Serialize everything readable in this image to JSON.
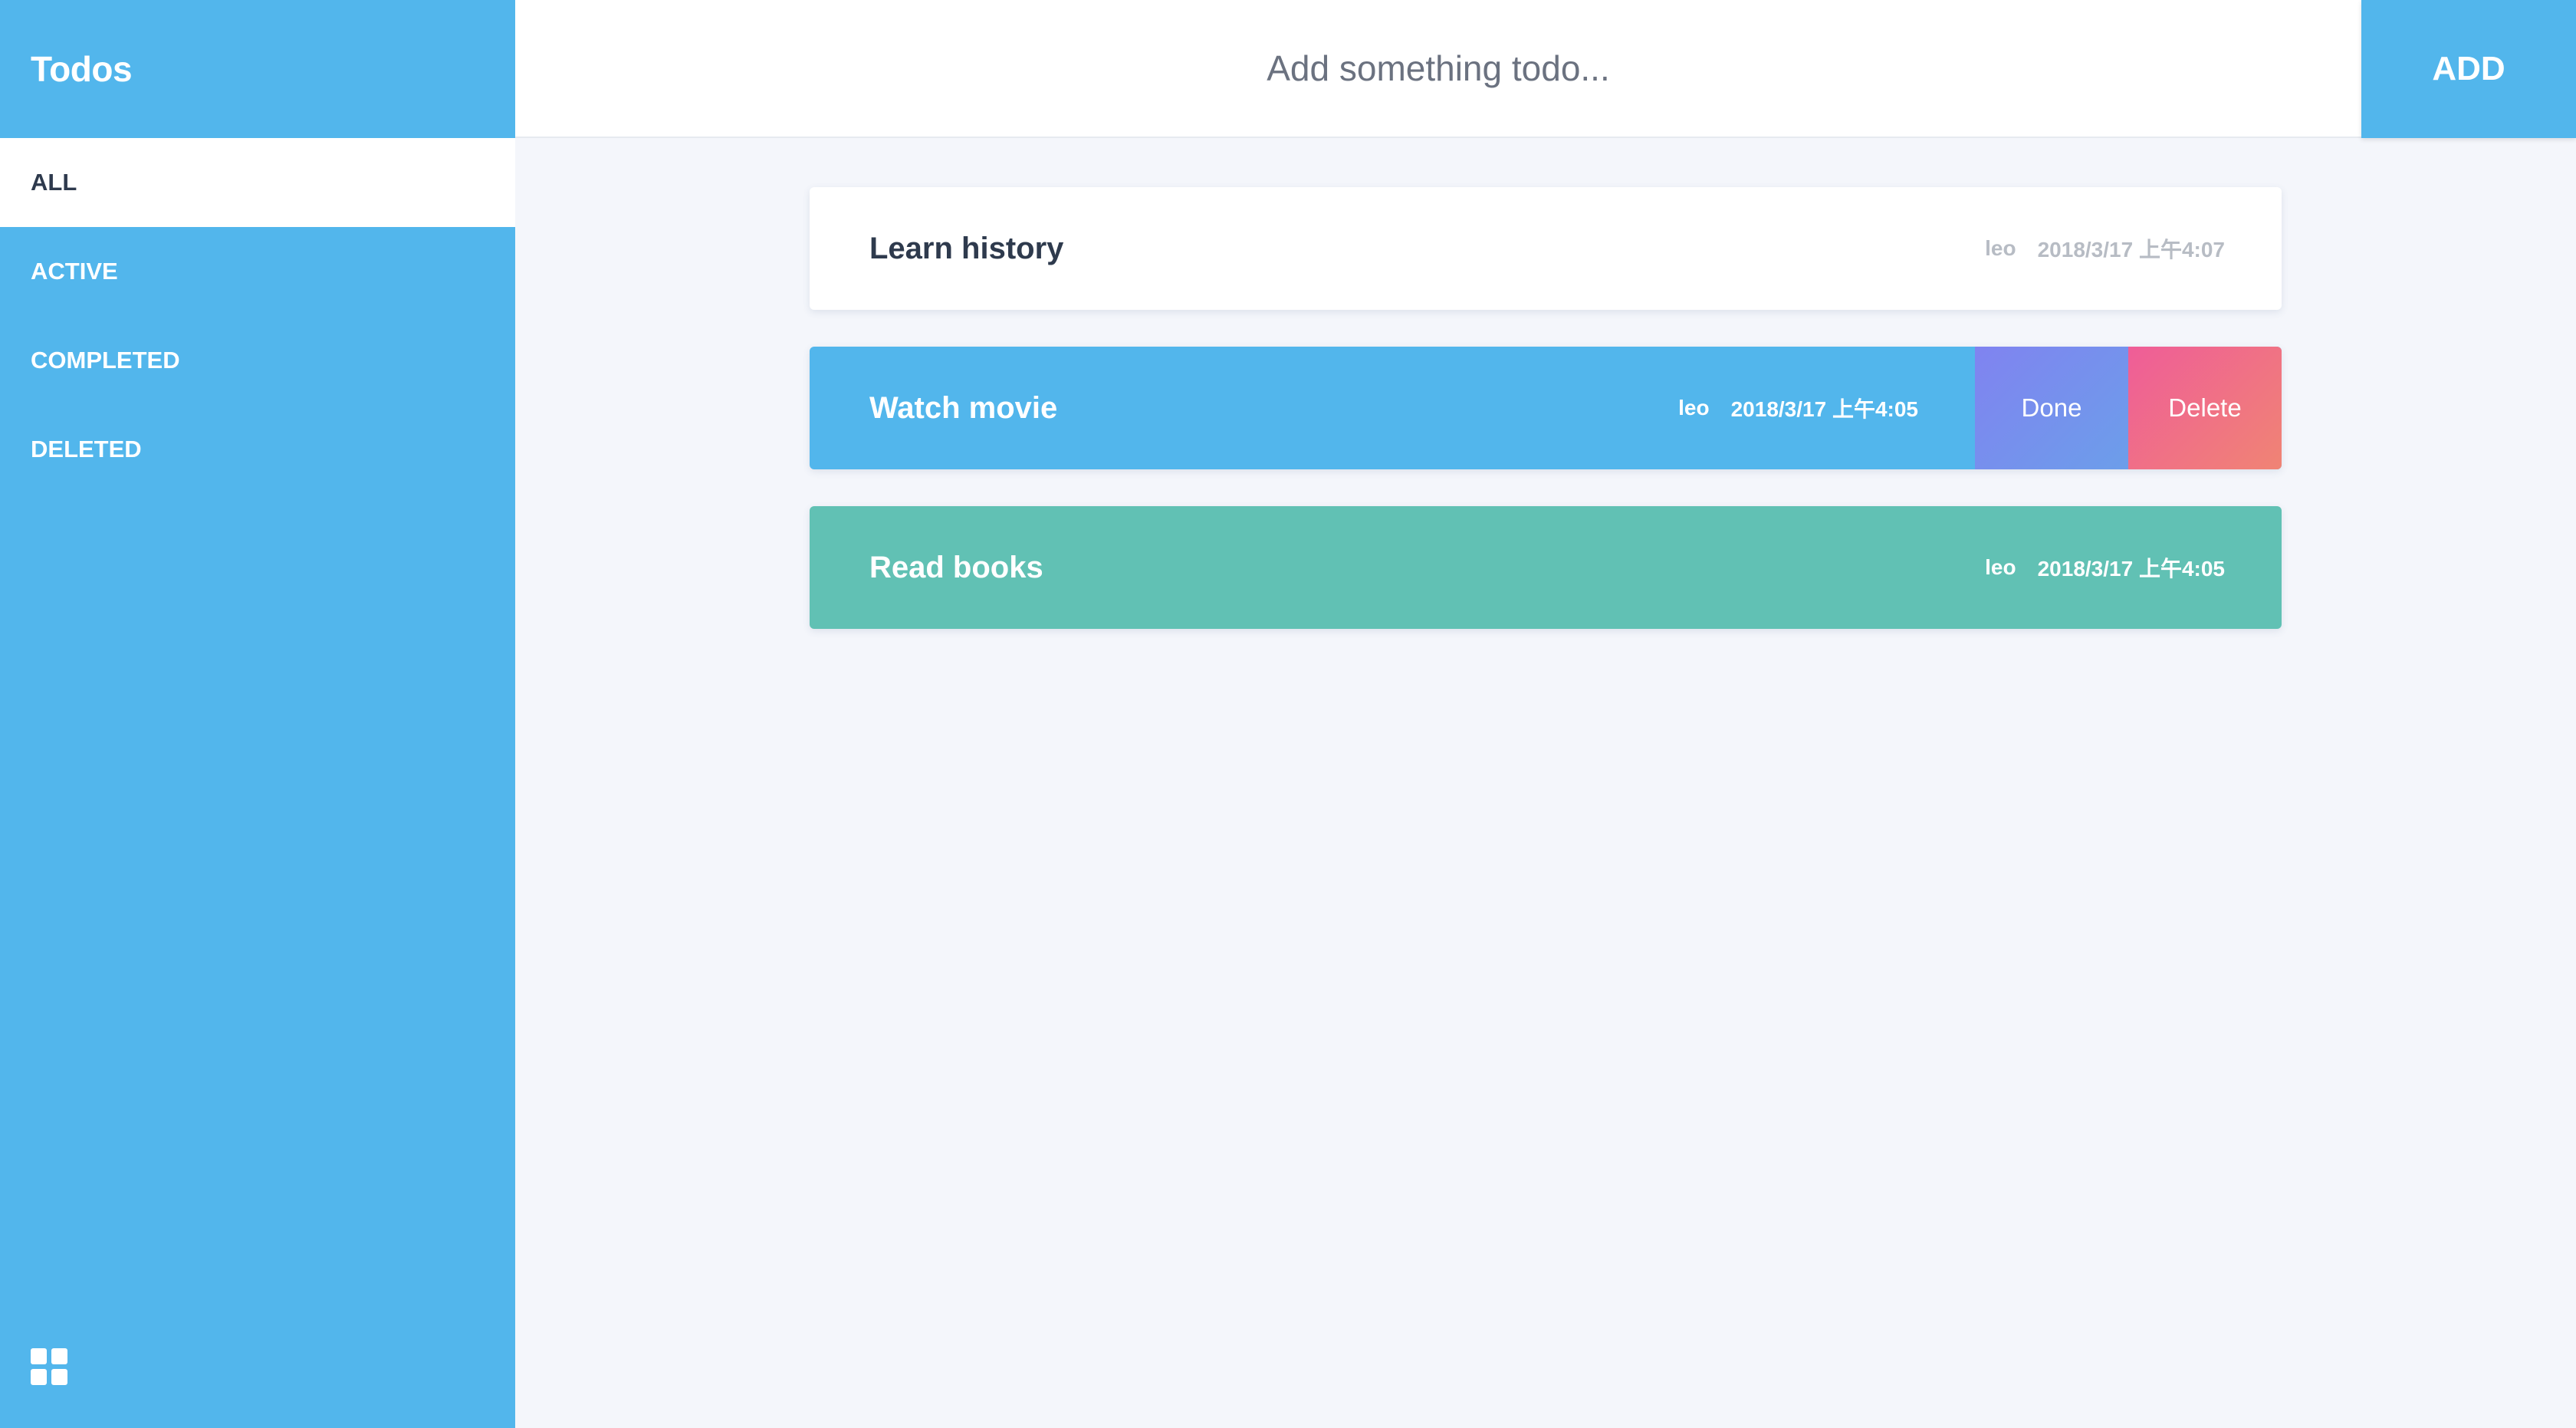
{
  "app": {
    "title": "Todos"
  },
  "sidebar": {
    "items": [
      {
        "label": "ALL",
        "active": true
      },
      {
        "label": "ACTIVE",
        "active": false
      },
      {
        "label": "COMPLETED",
        "active": false
      },
      {
        "label": "DELETED",
        "active": false
      }
    ],
    "bottom_icon": "grid-icon"
  },
  "header": {
    "input_placeholder": "Add something todo...",
    "input_value": "",
    "add_label": "ADD"
  },
  "todos": [
    {
      "title": "Learn history",
      "author": "leo",
      "time": "2018/3/17 上午4:07",
      "state": "default"
    },
    {
      "title": "Watch movie",
      "author": "leo",
      "time": "2018/3/17 上午4:05",
      "state": "hover",
      "actions": {
        "done_label": "Done",
        "delete_label": "Delete"
      }
    },
    {
      "title": "Read books",
      "author": "leo",
      "time": "2018/3/17 上午4:05",
      "state": "completed"
    }
  ],
  "colors": {
    "primary": "#52b6ec",
    "completed": "#61c1b4",
    "background": "#f4f6fb",
    "text_dark": "#2e3a4d",
    "meta_gray": "#b7bcc4",
    "done_gradient": [
      "#8083f0",
      "#6c9eea"
    ],
    "delete_gradient": [
      "#ef5d98",
      "#f08474"
    ]
  }
}
